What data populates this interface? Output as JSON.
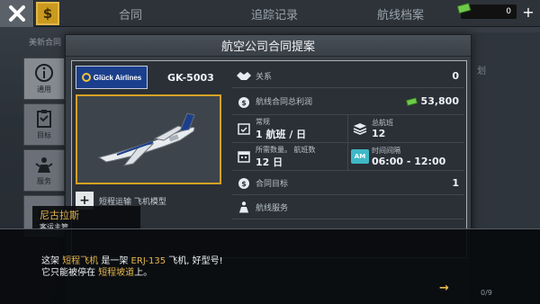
{
  "topbar": {
    "tabs": [
      "合同",
      "追踪记录",
      "航线档案"
    ],
    "money": "0",
    "plus": "+"
  },
  "background": {
    "left_label": "美新合同",
    "right_label": "划"
  },
  "side_nav": {
    "items": [
      {
        "label": "通用",
        "icon": "info-icon"
      },
      {
        "label": "目标",
        "icon": "clipboard-icon"
      },
      {
        "label": "服务",
        "icon": "service-icon"
      },
      {
        "label": "",
        "icon": "handshake-icon"
      }
    ]
  },
  "modal": {
    "title": "航空公司合同提案",
    "airline": "Glück Airlines",
    "contract_code": "GK-5003",
    "aircraft_type_label": "短程运输 飞机模型",
    "relation_label": "关系",
    "relation_value": "0",
    "profit_label": "航线合同总利润",
    "profit_value": "53,800",
    "regular_label": "常规",
    "regular_value": "1 航班 / 日",
    "total_flights_label": "总航班",
    "total_flights_value": "12",
    "days_label": "所需数量。 航班数",
    "days_value": "12 日",
    "time_label": "时间间隔",
    "time_value": "06:00 - 12:00",
    "am_badge": "AM",
    "contract_goal_label": "合同目标",
    "contract_goal_value": "1",
    "route_service_label": "航线服务"
  },
  "dialog": {
    "speaker_name": "尼古拉斯",
    "speaker_role": "客运主管",
    "line1_a": "这架 ",
    "line1_b": "短程飞机",
    "line1_c": " 是一架 ",
    "line1_d": "ERJ-135",
    "line1_e": " 飞机, 好型号!",
    "line2_a": "它只能被停在 ",
    "line2_b": "短程坡道",
    "line2_c": "上。",
    "next": "→",
    "page": "0/9"
  },
  "colors": {
    "accent_gold": "#d4a223",
    "highlight_text": "#e6b64c",
    "am_badge": "#3fb8c7",
    "money_green": "#6fc94a"
  }
}
